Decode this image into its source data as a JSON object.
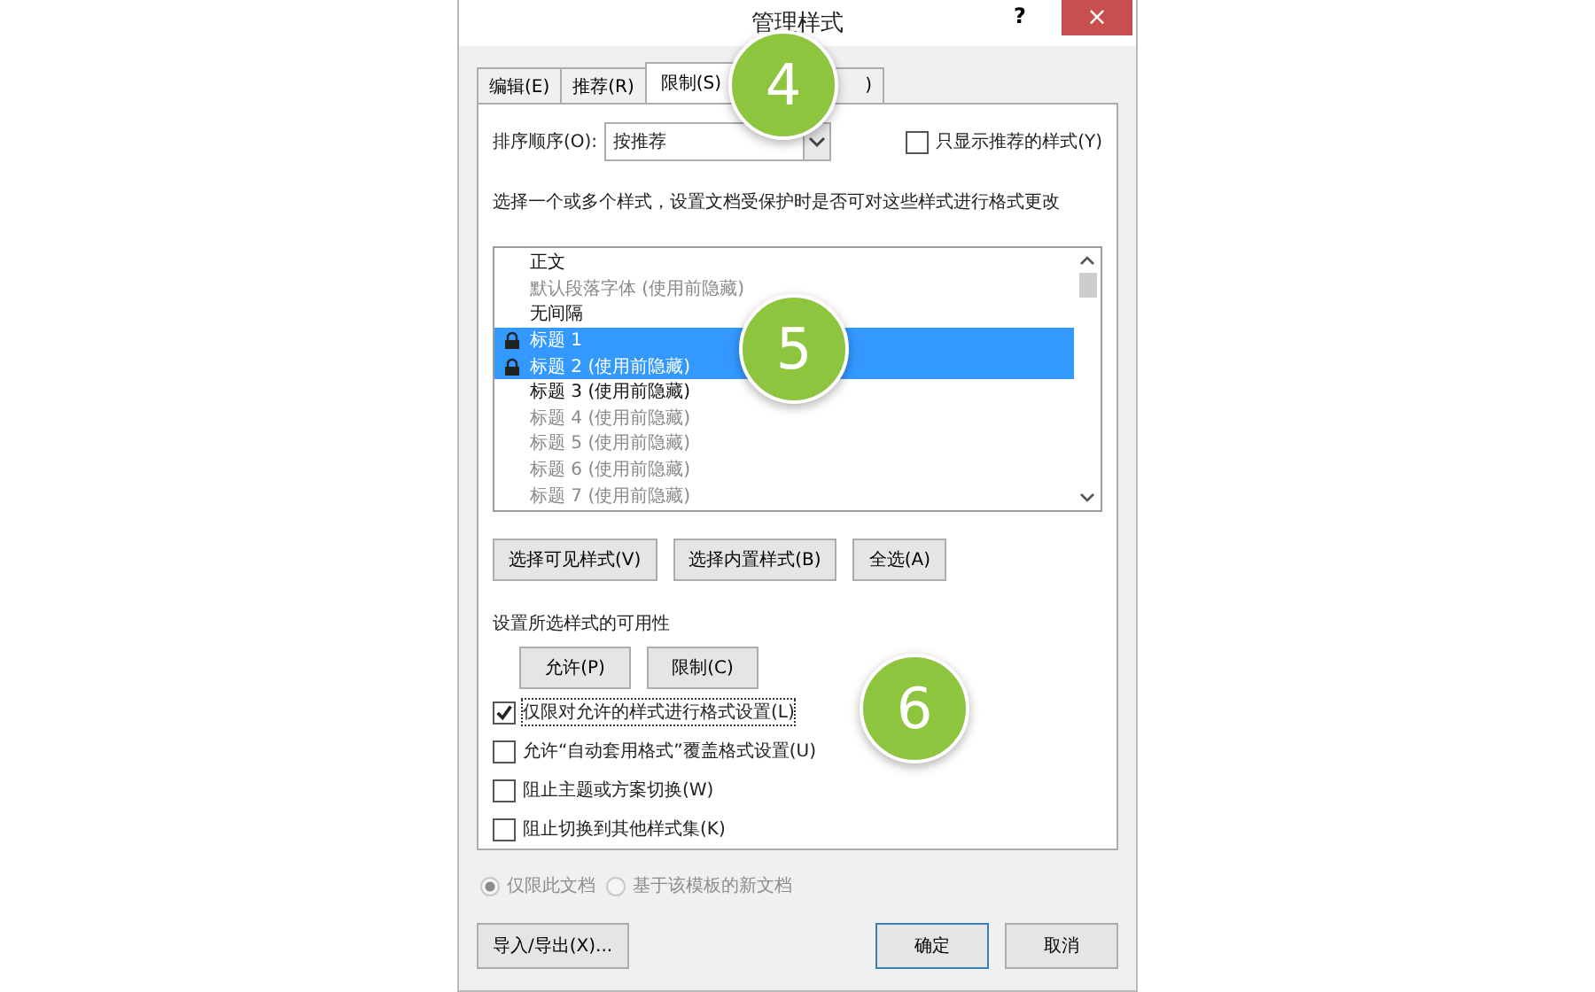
{
  "window": {
    "title": "管理样式",
    "help": "?",
    "close": "×"
  },
  "tabs": [
    {
      "label": "编辑(E)",
      "selected": false
    },
    {
      "label": "推荐(R)",
      "selected": false
    },
    {
      "label": "限制(S)",
      "selected": true
    },
    {
      "label": ")",
      "selected": false
    }
  ],
  "sort": {
    "label": "排序顺序(O):",
    "value": "按推荐"
  },
  "show_recommended": {
    "label": "只显示推荐的样式(Y)",
    "checked": false
  },
  "description": "选择一个或多个样式，设置文档受保护时是否可对这些样式进行格式更改",
  "styles": [
    {
      "name": "正文",
      "dimmed": false,
      "selected": false,
      "locked": false
    },
    {
      "name": "默认段落字体 (使用前隐藏)",
      "dimmed": true,
      "selected": false,
      "locked": false
    },
    {
      "name": "无间隔",
      "dimmed": false,
      "selected": false,
      "locked": false
    },
    {
      "name": "标题 1",
      "dimmed": false,
      "selected": true,
      "locked": true
    },
    {
      "name": "标题 2 (使用前隐藏)",
      "dimmed": false,
      "selected": true,
      "locked": true
    },
    {
      "name": "标题 3 (使用前隐藏)",
      "dimmed": false,
      "selected": false,
      "locked": false
    },
    {
      "name": "标题 4 (使用前隐藏)",
      "dimmed": true,
      "selected": false,
      "locked": false
    },
    {
      "name": "标题 5 (使用前隐藏)",
      "dimmed": true,
      "selected": false,
      "locked": false
    },
    {
      "name": "标题 6 (使用前隐藏)",
      "dimmed": true,
      "selected": false,
      "locked": false
    },
    {
      "name": "标题 7 (使用前隐藏)",
      "dimmed": true,
      "selected": false,
      "locked": false
    }
  ],
  "select_buttons": [
    "选择可见样式(V)",
    "选择内置样式(B)",
    "全选(A)"
  ],
  "availability": {
    "label": "设置所选样式的可用性",
    "buttons": [
      "允许(P)",
      "限制(C)"
    ]
  },
  "options": [
    {
      "label": "仅限对允许的样式进行格式设置(L)",
      "checked": true,
      "focused": true
    },
    {
      "label": "允许“自动套用格式”覆盖格式设置(U)",
      "checked": false,
      "focused": false
    },
    {
      "label": "阻止主题或方案切换(W)",
      "checked": false,
      "focused": false
    },
    {
      "label": "阻止切换到其他样式集(K)",
      "checked": false,
      "focused": false
    }
  ],
  "scope": [
    {
      "label": "仅限此文档",
      "selected": true,
      "disabled": true
    },
    {
      "label": "基于该模板的新文档",
      "selected": false,
      "disabled": true
    }
  ],
  "footer": {
    "import_export": "导入/导出(X)...",
    "ok": "确定",
    "cancel": "取消"
  },
  "callouts": [
    {
      "number": "4",
      "kind": "tabs"
    },
    {
      "number": "5",
      "kind": "list"
    },
    {
      "number": "6",
      "kind": "options"
    }
  ]
}
